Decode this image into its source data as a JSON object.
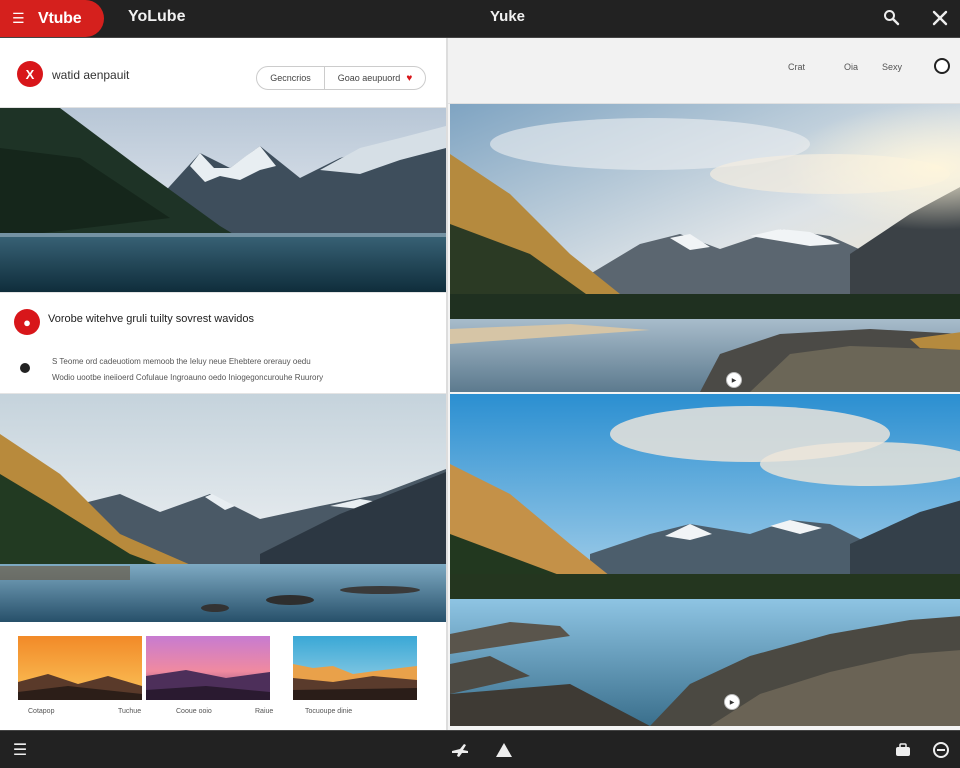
{
  "topbar": {
    "logo_text": "Vtube",
    "brand": "YoLube",
    "center_title": "Yuke",
    "icons": [
      "menu-icon",
      "search-icon",
      "close-icon"
    ]
  },
  "left": {
    "header": {
      "avatar_letter": "X",
      "channel_label": "watid aenpauit",
      "seg_a": "Gecncrios",
      "seg_b": "Goao aeupuord"
    },
    "info": {
      "avatar_letter": "●",
      "title": "Vorobe witehve gruli tuilty sovrest wavidos",
      "desc_line1": "S Teome ord cadeuotiom memoob the Ieluy neue Ehebtere orerauy oedu",
      "desc_line2": "Wodio uootbe ineiioerd Cofulaue Ingroauno oedo Iniogegoncurouhe Ruurory"
    },
    "thumbs": [
      {
        "label": "Cotapop",
        "color_top": "#f7a730",
        "color_bottom": "#c9722a"
      },
      {
        "label": "Tuchue",
        "color_top": "#e65aa0",
        "color_bottom": "#6b3d8e"
      },
      {
        "label": "Cooue ooio",
        "color_top": "#47b8d8",
        "color_bottom": "#f0a04a"
      },
      {
        "label": "Raiue",
        "color_top": "#47b8d8",
        "color_bottom": "#f0a04a"
      },
      {
        "label": "Tocuoupe dinie",
        "color_top": "#47b8d8",
        "color_bottom": "#f0a04a"
      }
    ]
  },
  "right": {
    "header_items": [
      "Crat",
      "Oia",
      "Sexy"
    ]
  },
  "colors": {
    "brand_red": "#d5201d",
    "bar_dark": "#222222"
  }
}
